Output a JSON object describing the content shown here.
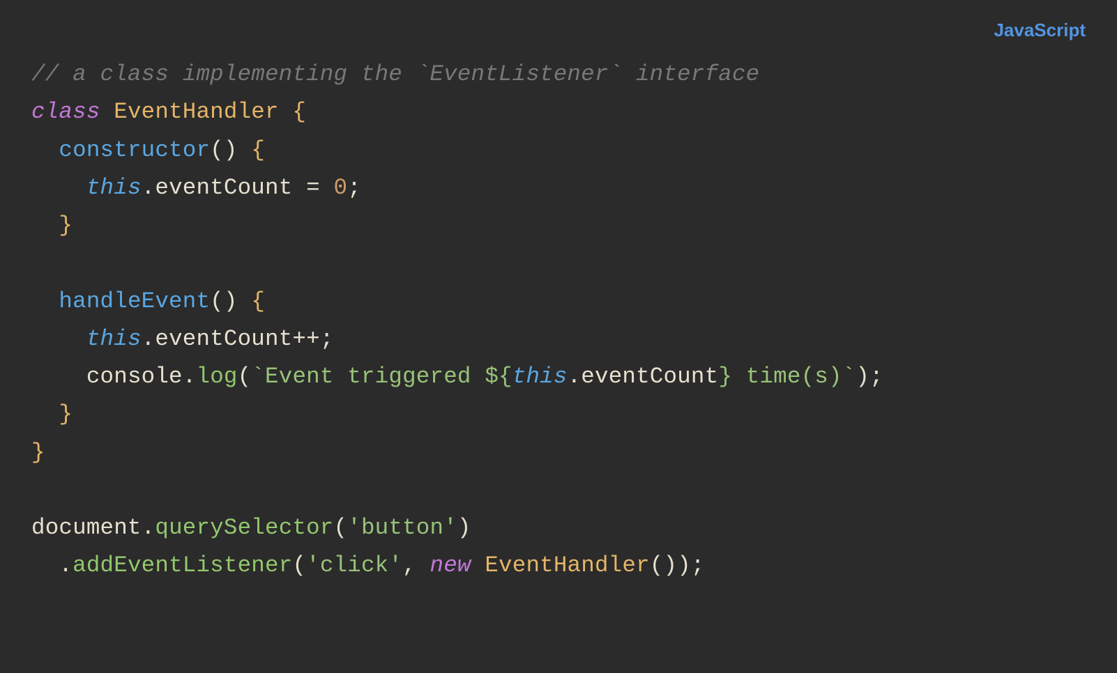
{
  "language_label": "JavaScript",
  "code": {
    "line1": {
      "comment": "// a class implementing the `EventListener` interface"
    },
    "line2": {
      "keyword": "class",
      "class_name": "EventHandler",
      "brace": "{"
    },
    "line3": {
      "indent": "  ",
      "function": "constructor",
      "parens": "()",
      "brace": "{"
    },
    "line4": {
      "indent": "    ",
      "this": "this",
      "dot": ".",
      "property": "eventCount",
      "op": " = ",
      "number": "0",
      "semi": ";"
    },
    "line5": {
      "indent": "  ",
      "brace": "}"
    },
    "line6": {
      "blank": ""
    },
    "line7": {
      "indent": "  ",
      "function": "handleEvent",
      "parens": "()",
      "brace": "{"
    },
    "line8": {
      "indent": "    ",
      "this": "this",
      "dot": ".",
      "property": "eventCount",
      "op": "++;"
    },
    "line9": {
      "indent": "    ",
      "console": "console",
      "dot": ".",
      "log": "log",
      "paren_open": "(",
      "tmpl_open": "`",
      "str1": "Event triggered ",
      "interp_open": "${",
      "this": "this",
      "dot2": ".",
      "property": "eventCount",
      "interp_close": "}",
      "str2": " time(s)",
      "tmpl_close": "`",
      "paren_close": ")",
      "semi": ";"
    },
    "line10": {
      "indent": "  ",
      "brace": "}"
    },
    "line11": {
      "brace": "}"
    },
    "line12": {
      "blank": ""
    },
    "line13": {
      "document": "document",
      "dot": ".",
      "method": "querySelector",
      "paren_open": "(",
      "string": "'button'",
      "paren_close": ")"
    },
    "line14": {
      "indent": "  ",
      "dot": ".",
      "method": "addEventListener",
      "paren_open": "(",
      "string": "'click'",
      "comma": ", ",
      "new": "new",
      "space": " ",
      "class_name": "EventHandler",
      "parens": "()",
      "paren_close": ")",
      "semi": ";"
    }
  }
}
